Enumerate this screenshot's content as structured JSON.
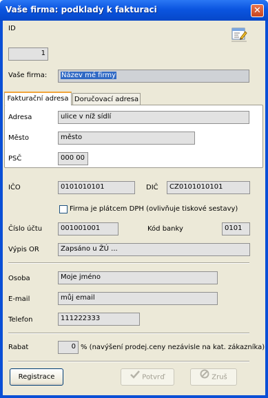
{
  "window": {
    "title": "Vaše firma: podklady k fakturaci",
    "close_symbol": "✕"
  },
  "id_section": {
    "label": "ID",
    "value": "1"
  },
  "company": {
    "label": "Vaše firma:",
    "value": "Název mé firmy"
  },
  "tabs": [
    {
      "label": "Fakturační adresa",
      "active": true
    },
    {
      "label": "Doručovací adresa",
      "active": false
    }
  ],
  "address": {
    "street_label": "Adresa",
    "street_value": "ulice v níž sídlí",
    "city_label": "Město",
    "city_value": "město",
    "zip_label": "PSČ",
    "zip_value": "000 00"
  },
  "tax": {
    "ico_label": "IČO",
    "ico_value": "0101010101",
    "dic_label": "DIČ",
    "dic_value": "CZ0101010101",
    "vat_payer_label": "Firma je plátcem DPH (ovlivňuje tiskové sestavy)",
    "vat_payer_checked": false
  },
  "bank": {
    "account_label": "Číslo účtu",
    "account_value": "001001001",
    "bank_code_label": "Kód banky",
    "bank_code_value": "0101"
  },
  "register": {
    "label": "Výpis OR",
    "value": "Zapsáno u ŽÚ ..."
  },
  "contact": {
    "person_label": "Osoba",
    "person_value": "Moje jméno",
    "email_label": "E-mail",
    "email_value": "můj email",
    "phone_label": "Telefon",
    "phone_value": "111222333"
  },
  "discount": {
    "label": "Rabat",
    "value": "0",
    "note": "% (navýšení prodej.ceny nezávisle na kat. zákazníka)"
  },
  "buttons": {
    "register": "Registrace",
    "confirm": "Potvrď",
    "cancel": "Zruš"
  },
  "colors": {
    "title_bar": "#0b55e0",
    "dialog_bg": "#ece9d8",
    "field_bg": "#e2e2e2",
    "selection": "#316ac5",
    "tab_highlight": "#f1a43a"
  },
  "icons": {
    "edit": "edit-form-icon",
    "confirm": "checkmark-icon",
    "cancel": "cancel-circle-icon"
  }
}
